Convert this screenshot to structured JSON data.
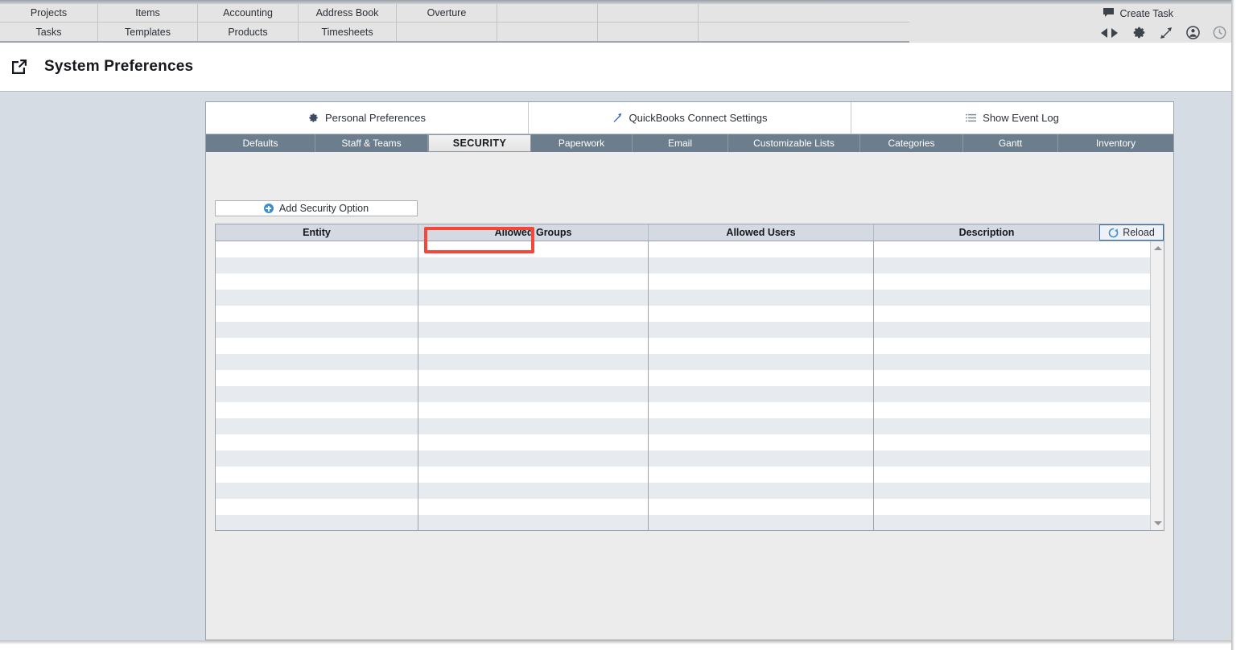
{
  "menu": {
    "row1": [
      {
        "label": "Projects"
      },
      {
        "label": "Items"
      },
      {
        "label": "Accounting"
      },
      {
        "label": "Address Book"
      },
      {
        "label": "Overture"
      },
      {
        "label": ""
      },
      {
        "label": ""
      }
    ],
    "row2": [
      {
        "label": "Tasks"
      },
      {
        "label": "Templates"
      },
      {
        "label": "Products"
      },
      {
        "label": "Timesheets"
      },
      {
        "label": ""
      },
      {
        "label": ""
      },
      {
        "label": ""
      }
    ]
  },
  "toolbar": {
    "create_task_label": "Create Task",
    "icons": [
      "back-forward-arrows-icon",
      "gear-icon",
      "expand-icon",
      "user-icon",
      "clock-icon"
    ]
  },
  "header": {
    "open_icon": "open-external-icon",
    "title": "System Preferences"
  },
  "top_buttons": [
    {
      "label": "Personal Preferences",
      "icon": "gear-icon"
    },
    {
      "label": "QuickBooks Connect Settings",
      "icon": "arrow-diagonal-icon"
    },
    {
      "label": "Show Event Log",
      "icon": "list-icon"
    }
  ],
  "tabs": [
    {
      "label": "Defaults",
      "active": false
    },
    {
      "label": "Staff & Teams",
      "active": false
    },
    {
      "label": "SECURITY",
      "active": true
    },
    {
      "label": "Paperwork",
      "active": false
    },
    {
      "label": "Email",
      "active": false
    },
    {
      "label": "Customizable Lists",
      "active": false
    },
    {
      "label": "Categories",
      "active": false
    },
    {
      "label": "Gantt",
      "active": false
    },
    {
      "label": "Inventory",
      "active": false
    }
  ],
  "actions": {
    "add_security_option_label": "Add Security Option",
    "add_icon": "plus-circle-icon",
    "reload_label": "Reload",
    "reload_icon": "refresh-icon"
  },
  "grid": {
    "columns": [
      "Entity",
      "Allowed Groups",
      "Allowed Users",
      "Description"
    ],
    "rows": [],
    "empty_row_count": 18
  },
  "colors": {
    "accent_blue": "#3a8fd4",
    "tab_bar": "#6c7d8d",
    "page_background": "#d6dce4",
    "panel_background": "#ececec",
    "highlight_red": "#f4473a",
    "grid_header": "#d5dae2",
    "row_alt": "#e7eaef"
  }
}
